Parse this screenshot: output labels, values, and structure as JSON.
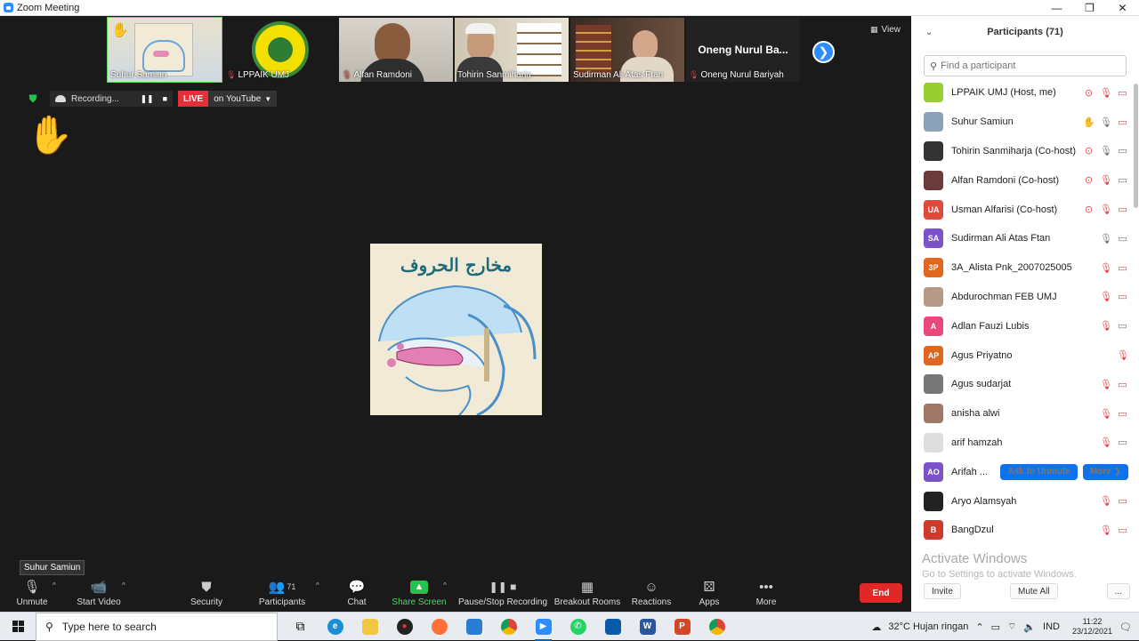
{
  "window": {
    "title": "Zoom Meeting",
    "minimize": "—",
    "restore": "❐",
    "close": "✕"
  },
  "thumbnails": [
    {
      "name": "Suhur Samiun",
      "mic_muted": false,
      "hand": true,
      "active": true,
      "kind": "image"
    },
    {
      "name": "LPPAIK UMJ",
      "mic_muted": true,
      "hand": false,
      "active": false,
      "kind": "logo"
    },
    {
      "name": "Alfan Ramdoni",
      "mic_muted": true,
      "hand": false,
      "active": false,
      "kind": "video"
    },
    {
      "name": "Tohirin Sanmiharja",
      "mic_muted": false,
      "hand": false,
      "active": false,
      "kind": "video"
    },
    {
      "name": "Sudirman Ali Atas Ftan",
      "mic_muted": false,
      "hand": false,
      "active": false,
      "kind": "video"
    },
    {
      "name": "Oneng Nurul Bariyah",
      "display": "Oneng Nurul Ba...",
      "mic_muted": true,
      "hand": false,
      "active": false,
      "kind": "name"
    }
  ],
  "view_label": "View",
  "recording": {
    "label": "Recording...",
    "live": "LIVE",
    "stream": "on YouTube"
  },
  "shared": {
    "title": "مخارج الحروف"
  },
  "tooltip": "Suhur Samiun",
  "toolbar": {
    "unmute": "Unmute",
    "start_video": "Start Video",
    "security": "Security",
    "participants": "Participants",
    "participants_count": "71",
    "chat": "Chat",
    "share_screen": "Share Screen",
    "pause_stop": "Pause/Stop Recording",
    "breakout": "Breakout Rooms",
    "reactions": "Reactions",
    "apps": "Apps",
    "more": "More",
    "end": "End"
  },
  "panel": {
    "title": "Participants (71)",
    "search_placeholder": "Find a participant",
    "participants": [
      {
        "name": "LPPAIK UMJ (Host, me)",
        "avatar": "",
        "color": "#9acd32",
        "icons": [
          "rec",
          "mic-off",
          "cam-off"
        ]
      },
      {
        "name": "Suhur Samiun",
        "avatar": "",
        "color": "#8aa3b8",
        "icons": [
          "hand",
          "mic",
          "cam-off"
        ]
      },
      {
        "name": "Tohirin Sanmiharja (Co-host)",
        "avatar": "",
        "color": "#333333",
        "icons": [
          "rec",
          "mic",
          "cam"
        ]
      },
      {
        "name": "Alfan Ramdoni (Co-host)",
        "avatar": "",
        "color": "#6b3a3a",
        "icons": [
          "rec",
          "mic-off",
          "cam"
        ]
      },
      {
        "name": "Usman Alfarisi (Co-host)",
        "avatar": "UA",
        "color": "#e04a3a",
        "icons": [
          "rec",
          "mic-off",
          "cam-off"
        ]
      },
      {
        "name": "Sudirman Ali Atas Ftan",
        "avatar": "SA",
        "color": "#7b52c7",
        "icons": [
          "mic",
          "cam"
        ]
      },
      {
        "name": "3A_Alista Pnk_2007025005",
        "avatar": "3P",
        "color": "#e0671f",
        "icons": [
          "mic-off",
          "cam-off"
        ]
      },
      {
        "name": "Abdurochman FEB UMJ",
        "avatar": "",
        "color": "#b59a88",
        "icons": [
          "mic-off",
          "cam-off"
        ]
      },
      {
        "name": "Adlan Fauzi Lubis",
        "avatar": "A",
        "color": "#e8487a",
        "icons": [
          "mic-off",
          "cam"
        ]
      },
      {
        "name": "Agus Priyatno",
        "avatar": "AP",
        "color": "#e0671f",
        "icons": [
          "mic-off"
        ]
      },
      {
        "name": "Agus sudarjat",
        "avatar": "",
        "color": "#777777",
        "icons": [
          "mic-off",
          "cam-off"
        ]
      },
      {
        "name": "anisha alwi",
        "avatar": "",
        "color": "#a07866",
        "icons": [
          "mic-off",
          "cam-off"
        ]
      },
      {
        "name": "arif hamzah",
        "avatar": "",
        "color": "#dddddd",
        "icons": [
          "mic-off",
          "cam"
        ]
      },
      {
        "name": "Arifah ...",
        "avatar": "AO",
        "color": "#7b52c7",
        "icons": [],
        "ask": "Ask to Unmute",
        "more": "More ❯"
      },
      {
        "name": "Aryo Alamsyah",
        "avatar": "",
        "color": "#222222",
        "icons": [
          "mic-off",
          "cam-off"
        ]
      },
      {
        "name": "BangDzul",
        "avatar": "B",
        "color": "#d03a2a",
        "icons": [
          "mic-off",
          "cam-off"
        ]
      }
    ],
    "activate_title": "Activate Windows",
    "activate_sub": "Go to Settings to activate Windows.",
    "invite": "Invite",
    "mute_all": "Mute All",
    "more_dots": "..."
  },
  "taskbar": {
    "search_placeholder": "Type here to search",
    "weather": "32°C  Hujan ringan",
    "lang": "IND",
    "time": "11:22",
    "date": "23/12/2021"
  }
}
